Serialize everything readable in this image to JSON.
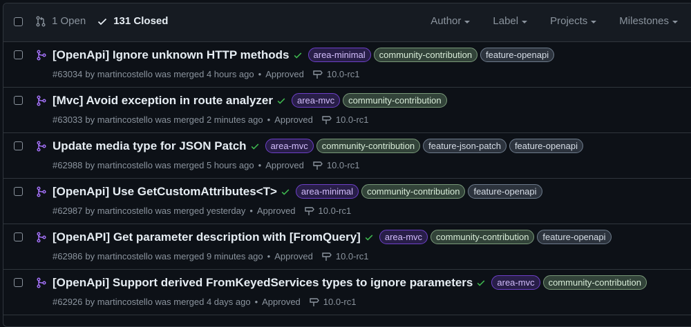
{
  "header": {
    "open_label": "1 Open",
    "closed_label": "131 Closed",
    "filters": [
      "Author",
      "Label",
      "Projects",
      "Milestones"
    ]
  },
  "colors": {
    "area-minimal": "#b392f0",
    "area-mvc": "#b392f0",
    "community-contribution": "#a8d8a8",
    "feature": "#b6c4d2",
    "merged": "#a371f7",
    "check": "#3fb950"
  },
  "pulls": [
    {
      "title": "[OpenApi] Ignore unknown HTTP methods",
      "labels": [
        "area-minimal",
        "community-contribution",
        "feature-openapi"
      ],
      "number": "#63034",
      "by": "by martincostello was merged 4 hours ago",
      "review": "Approved",
      "milestone": "10.0-rc1"
    },
    {
      "title": "[Mvc] Avoid exception in route analyzer",
      "labels": [
        "area-mvc",
        "community-contribution"
      ],
      "number": "#63033",
      "by": "by martincostello was merged 2 minutes ago",
      "review": "Approved",
      "milestone": "10.0-rc1"
    },
    {
      "title": "Update media type for JSON Patch",
      "labels": [
        "area-mvc",
        "community-contribution",
        "feature-json-patch",
        "feature-openapi"
      ],
      "number": "#62988",
      "by": "by martincostello was merged 5 hours ago",
      "review": "Approved",
      "milestone": "10.0-rc1"
    },
    {
      "title": "[OpenApi] Use GetCustomAttributes<T>",
      "labels": [
        "area-minimal",
        "community-contribution",
        "feature-openapi"
      ],
      "number": "#62987",
      "by": "by martincostello was merged yesterday",
      "review": "Approved",
      "milestone": "10.0-rc1"
    },
    {
      "title": "[OpenAPI] Get parameter description with [FromQuery]",
      "labels": [
        "area-mvc",
        "community-contribution",
        "feature-openapi"
      ],
      "number": "#62986",
      "by": "by martincostello was merged 9 minutes ago",
      "review": "Approved",
      "milestone": "10.0-rc1"
    },
    {
      "title": "[OpenApi] Support derived FromKeyedServices types to ignore parameters",
      "labels": [
        "area-mvc",
        "community-contribution"
      ],
      "number": "#62926",
      "by": "by martincostello was merged 4 days ago",
      "review": "Approved",
      "milestone": "10.0-rc1"
    }
  ]
}
